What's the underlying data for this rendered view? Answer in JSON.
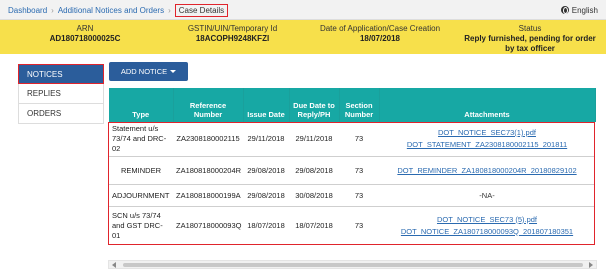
{
  "breadcrumb": {
    "items": [
      "Dashboard",
      "Additional Notices and Orders",
      "Case Details"
    ],
    "separator": "›"
  },
  "language": {
    "label": "English",
    "icon": "globe-icon"
  },
  "case_info": {
    "arn": {
      "label": "ARN",
      "value": "AD180718000025C"
    },
    "gstin": {
      "label": "GSTIN/UIN/Temporary Id",
      "value": "18ACOPH9248KFZI"
    },
    "date": {
      "label": "Date of Application/Case Creation",
      "value": "18/07/2018"
    },
    "status": {
      "label": "Status",
      "value": "Reply furnished, pending for order by tax officer"
    }
  },
  "side_tabs": [
    {
      "label": "NOTICES",
      "active": true
    },
    {
      "label": "REPLIES",
      "active": false
    },
    {
      "label": "ORDERS",
      "active": false
    }
  ],
  "add_notice": {
    "label": "ADD NOTICE"
  },
  "table": {
    "headers": [
      "Type",
      "Reference Number",
      "Issue Date",
      "Due Date to Reply/PH",
      "Section Number",
      "Attachments"
    ],
    "rows": [
      {
        "type": "Statement u/s 73/74 and DRC-02",
        "ref": "ZA2308180002115",
        "issue": "29/11/2018",
        "due": "29/11/2018",
        "section": "73",
        "attachments": [
          "DOT_NOTICE_SEC73(1).pdf",
          "DOT_STATEMENT_ZA2308180002115_201811"
        ]
      },
      {
        "type": "REMINDER",
        "ref": "ZA180818000204R",
        "issue": "29/08/2018",
        "due": "29/08/2018",
        "section": "73",
        "attachments": [
          "DOT_REMINDER_ZA180818000204R_20180829102"
        ]
      },
      {
        "type": "ADJOURNMENT",
        "ref": "ZA180818000199A",
        "issue": "29/08/2018",
        "due": "30/08/2018",
        "section": "73",
        "attachments_text": "-NA-"
      },
      {
        "type": "SCN u/s 73/74 and GST DRC-01",
        "ref": "ZA180718000093Q",
        "issue": "18/07/2018",
        "due": "18/07/2018",
        "section": "73",
        "attachments": [
          "DOT_NOTICE_SEC73 (5).pdf",
          "DOT_NOTICE_ZA180718000093Q_201807180351"
        ]
      }
    ]
  },
  "colors": {
    "banner": "#f7e04b",
    "header_teal": "#17a8a4",
    "primary_blue": "#2b5d9b",
    "highlight_red": "#e0242c",
    "link": "#2a6ab0"
  }
}
